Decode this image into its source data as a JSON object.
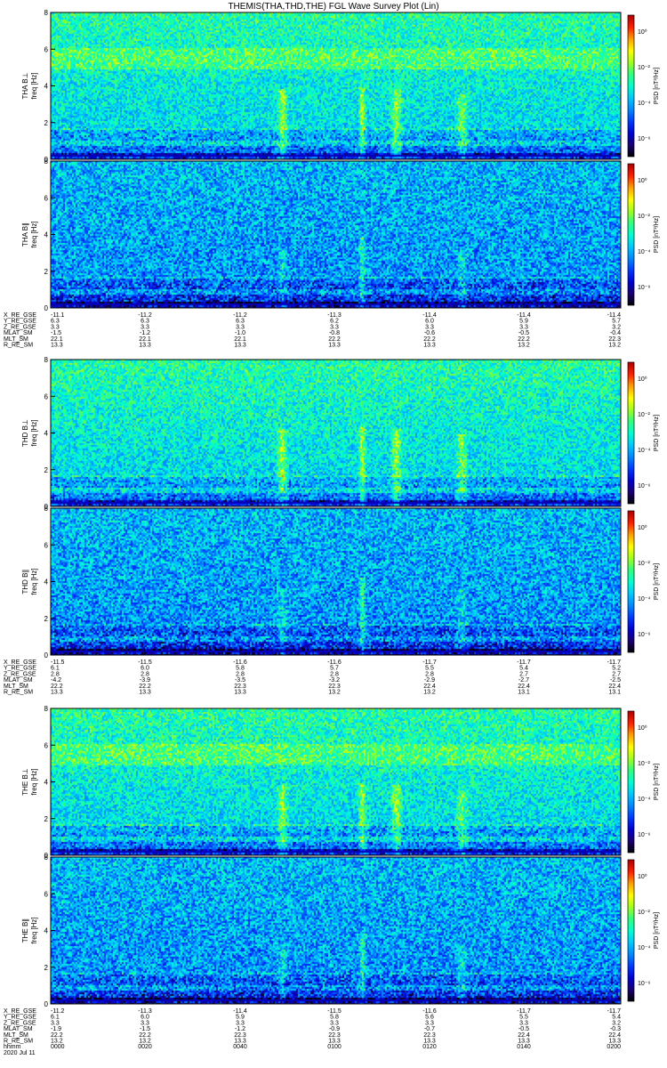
{
  "title": "THEMIS(THA,THD,THE) FGL Wave Survey Plot (Lin)",
  "freq_ticks": [
    "0",
    "2",
    "4",
    "6",
    "8"
  ],
  "cbar_ticks": [
    "10⁰",
    "10⁻²",
    "10⁻⁴",
    "10⁻⁶"
  ],
  "cbar_label": "PSD [nT²/Hz]",
  "colors": {
    "scale": [
      "#000000",
      "#1a0070",
      "#0000d0",
      "#0038ff",
      "#0088ff",
      "#00c8ff",
      "#00ffd0",
      "#30ff80",
      "#a0ff20",
      "#ffff00",
      "#ffa000",
      "#ff2000",
      "#b00000"
    ]
  },
  "blocks": [
    {
      "panels": [
        {
          "ylabel": "THA B⊥",
          "ylabel2": "freq [Hz]",
          "style": "perp"
        },
        {
          "ylabel": "THA B∥",
          "ylabel2": "freq [Hz]",
          "style": "para"
        }
      ],
      "ephem": [
        {
          "label": "X_RE_GSE",
          "values": [
            "-11.1",
            "-11.2",
            "-11.2",
            "-11.3",
            "-11.4",
            "-11.4",
            "-11.4"
          ]
        },
        {
          "label": "Y_RE_GSE",
          "values": [
            "6.3",
            "6.3",
            "6.3",
            "6.2",
            "6.0",
            "5.9",
            "5.7"
          ]
        },
        {
          "label": "Z_RE_GSE",
          "values": [
            "3.3",
            "3.3",
            "3.3",
            "3.3",
            "3.3",
            "3.3",
            "3.2"
          ]
        },
        {
          "label": "MLAT_SM",
          "values": [
            "-1.5",
            "-1.2",
            "-1.0",
            "-0.8",
            "-0.6",
            "-0.5",
            "-0.4"
          ]
        },
        {
          "label": "MLT_SM",
          "values": [
            "22.1",
            "22.1",
            "22.1",
            "22.2",
            "22.2",
            "22.2",
            "22.3"
          ]
        },
        {
          "label": "R_RE_SM",
          "values": [
            "13.3",
            "13.3",
            "13.3",
            "13.3",
            "13.3",
            "13.2",
            "13.2"
          ]
        }
      ]
    },
    {
      "panels": [
        {
          "ylabel": "THD B⊥",
          "ylabel2": "freq [Hz]",
          "style": "perp"
        },
        {
          "ylabel": "THD B∥",
          "ylabel2": "freq [Hz]",
          "style": "para"
        }
      ],
      "ephem": [
        {
          "label": "X_RE_GSE",
          "values": [
            "-11.5",
            "-11.5",
            "-11.6",
            "-11.6",
            "-11.7",
            "-11.7",
            "-11.7"
          ]
        },
        {
          "label": "Y_RE_GSE",
          "values": [
            "6.1",
            "6.0",
            "5.8",
            "5.7",
            "5.5",
            "5.4",
            "5.2"
          ]
        },
        {
          "label": "Z_RE_GSE",
          "values": [
            "2.8",
            "2.8",
            "2.8",
            "2.8",
            "2.8",
            "2.7",
            "2.7"
          ]
        },
        {
          "label": "MLAT_SM",
          "values": [
            "-4.2",
            "-3.9",
            "-3.5",
            "-3.2",
            "-2.9",
            "-2.7",
            "-2.5"
          ]
        },
        {
          "label": "MLT_SM",
          "values": [
            "22.2",
            "22.2",
            "22.3",
            "22.3",
            "22.4",
            "22.4",
            "22.4"
          ]
        },
        {
          "label": "R_RE_SM",
          "values": [
            "13.3",
            "13.3",
            "13.3",
            "13.2",
            "13.2",
            "13.1",
            "13.1"
          ]
        }
      ]
    },
    {
      "panels": [
        {
          "ylabel": "THE B⊥",
          "ylabel2": "freq [Hz]",
          "style": "perp"
        },
        {
          "ylabel": "THE B∥",
          "ylabel2": "freq [Hz]",
          "style": "para"
        }
      ],
      "ephem": [
        {
          "label": "X_RE_GSE",
          "values": [
            "-11.2",
            "-11.3",
            "-11.4",
            "-11.5",
            "-11.6",
            "-11.7",
            "-11.7"
          ]
        },
        {
          "label": "Y_RE_GSE",
          "values": [
            "6.1",
            "6.0",
            "5.9",
            "5.8",
            "5.6",
            "5.5",
            "5.4"
          ]
        },
        {
          "label": "Z_RE_GSE",
          "values": [
            "3.3",
            "3.3",
            "3.3",
            "3.3",
            "3.3",
            "3.3",
            "3.2"
          ]
        },
        {
          "label": "MLAT_SM",
          "values": [
            "-1.9",
            "-1.5",
            "-1.2",
            "-0.9",
            "-0.7",
            "-0.5",
            "-0.3"
          ]
        },
        {
          "label": "MLT_SM",
          "values": [
            "22.2",
            "22.2",
            "22.3",
            "22.3",
            "22.3",
            "22.4",
            "22.4"
          ]
        },
        {
          "label": "R_RE_SM",
          "values": [
            "13.2",
            "13.2",
            "13.3",
            "13.3",
            "13.3",
            "13.3",
            "13.3"
          ]
        },
        {
          "label": "hhmm",
          "values": [
            "0000",
            "0020",
            "0040",
            "0100",
            "0120",
            "0140",
            "0200"
          ]
        }
      ],
      "date": "2020 Jul 11"
    }
  ],
  "chart_data": {
    "type": "heatmap",
    "title": "THEMIS(THA,THD,THE) FGL Wave Survey Plot (Lin)",
    "x": {
      "label": "hhmm",
      "ticks": [
        "0000",
        "0020",
        "0040",
        "0100",
        "0120",
        "0140",
        "0200"
      ],
      "date": "2020 Jul 11"
    },
    "y": {
      "label": "freq [Hz]",
      "range": [
        0,
        8
      ],
      "ticks": [
        0,
        2,
        4,
        6,
        8
      ]
    },
    "z": {
      "label": "PSD [nT²/Hz]",
      "scale": "log",
      "range": [
        1e-07,
        10.0
      ],
      "ticks": [
        "10⁰",
        "10⁻²",
        "10⁻⁴",
        "10⁻⁶"
      ]
    },
    "panels": [
      "THA B⊥",
      "THA B∥",
      "THD B⊥",
      "THD B∥",
      "THE B⊥",
      "THE B∥"
    ]
  }
}
